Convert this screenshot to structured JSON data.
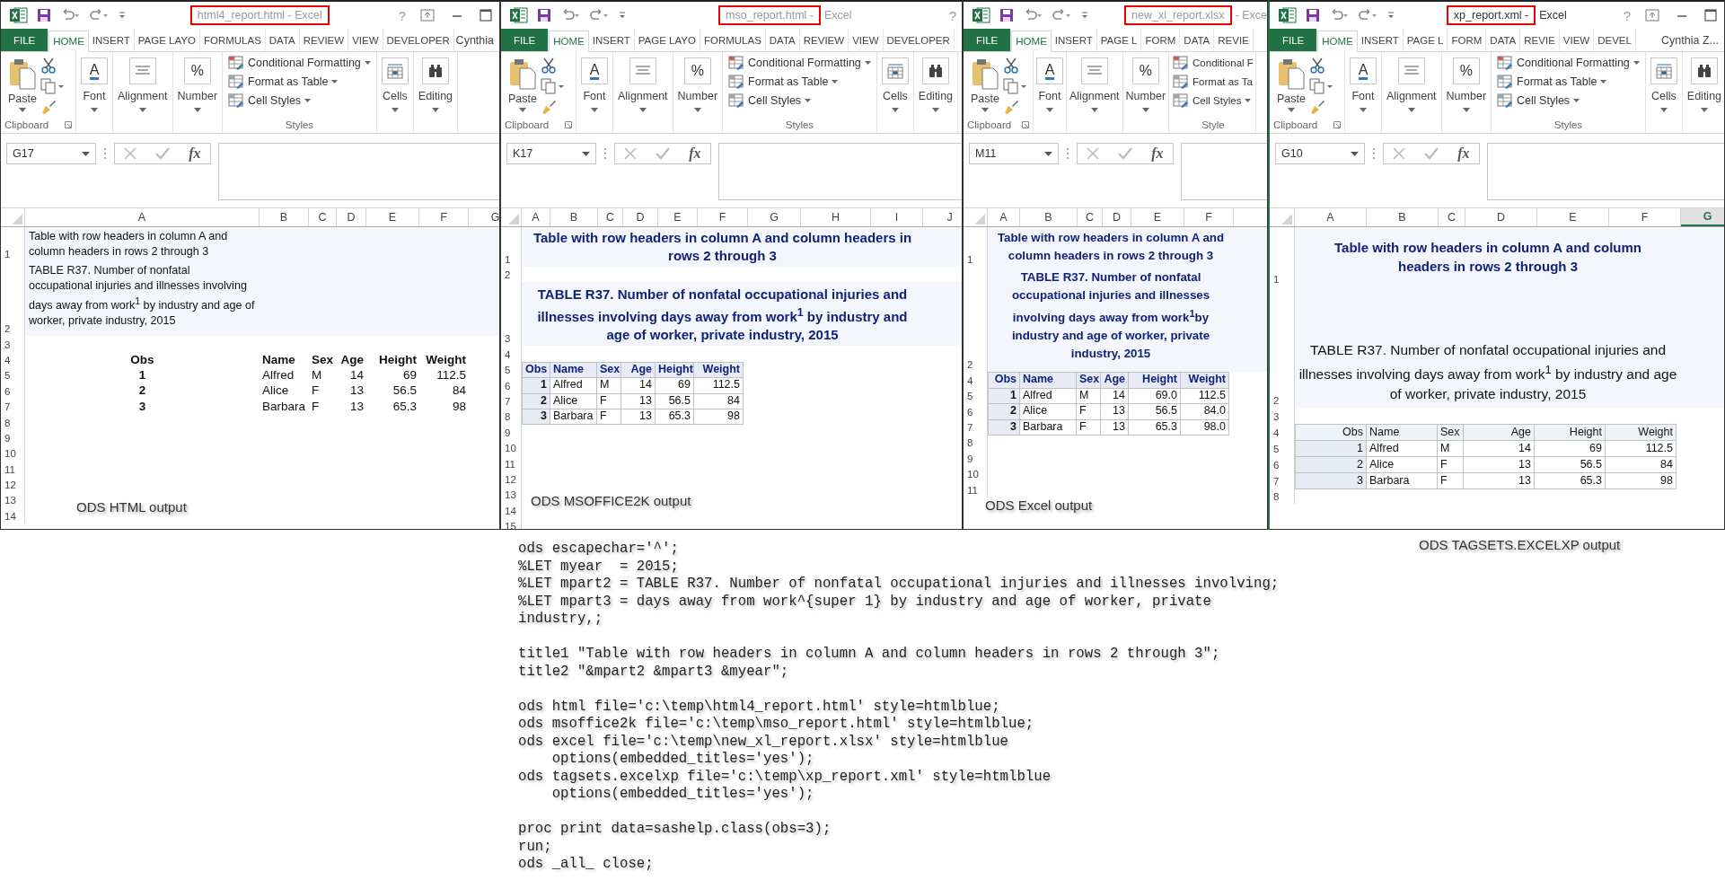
{
  "windows": [
    {
      "kind": "html",
      "title": {
        "highlighted": "html4_report.html - Excel"
      },
      "help": "?",
      "show_controls": true,
      "tabs": [
        {
          "label": "FILE",
          "kind": "file",
          "selected": false
        },
        {
          "label": "HOME",
          "kind": "tab",
          "selected": true
        },
        {
          "label": "INSERT",
          "kind": "tab",
          "selected": false
        },
        {
          "label": "PAGE LAYO",
          "kind": "tab",
          "selected": false
        },
        {
          "label": "FORMULAS",
          "kind": "tab",
          "selected": false
        },
        {
          "label": "DATA",
          "kind": "tab",
          "selected": false
        },
        {
          "label": "REVIEW",
          "kind": "tab",
          "selected": false
        },
        {
          "label": "VIEW",
          "kind": "tab",
          "selected": false
        },
        {
          "label": "DEVELOPER",
          "kind": "tab",
          "selected": false
        }
      ],
      "user": "Cynthia",
      "ribbon": {
        "clipboard": {
          "paste": "Paste",
          "label": "Clipboard"
        },
        "collapsed": [
          {
            "kind": "font",
            "label": "Font",
            "glyph": "A"
          },
          {
            "kind": "alignment",
            "label": "Alignment"
          },
          {
            "kind": "number",
            "label": "Number",
            "glyph": "%"
          }
        ],
        "styles": {
          "commands": [
            {
              "label": "Conditional Formatting",
              "caret": true
            },
            {
              "label": "Format as Table",
              "caret": true
            },
            {
              "label": "Cell Styles",
              "caret": true
            }
          ],
          "label": "Styles"
        },
        "tools": [
          {
            "kind": "cells",
            "label": "Cells"
          },
          {
            "kind": "editing",
            "label": "Editing"
          }
        ]
      },
      "formula_bar": {
        "name_box": "G17",
        "fx": "fx"
      },
      "columns": [
        {
          "label": "A",
          "selected": false
        },
        {
          "label": "B",
          "selected": false
        },
        {
          "label": "C",
          "selected": false
        },
        {
          "label": "D",
          "selected": false
        },
        {
          "label": "E",
          "selected": false
        },
        {
          "label": "F",
          "selected": false
        },
        {
          "label": "G",
          "selected": false
        }
      ],
      "rows": [
        {
          "number": "1",
          "kind": "title",
          "text": "Table with row headers in column A and column headers in rows 2 through 3"
        },
        {
          "number": "2",
          "kind": "subtitle",
          "text": "TABLE R37. Number of nonfatal occupational injuries and illnesses involving days away from work$^{1}$ by industry and age of worker, private industry, 2015"
        },
        {
          "number": "3",
          "kind": "empty"
        },
        {
          "number": "4",
          "kind": "header",
          "cells": [
            "Obs",
            "Name",
            "Sex",
            "Age",
            "Height",
            "Weight"
          ]
        },
        {
          "number": "5",
          "kind": "data",
          "cells": [
            "1",
            "Alfred",
            "M",
            "14",
            "69",
            "112.5"
          ]
        },
        {
          "number": "6",
          "kind": "data",
          "cells": [
            "2",
            "Alice",
            "F",
            "13",
            "56.5",
            "84"
          ]
        },
        {
          "number": "7",
          "kind": "data",
          "cells": [
            "3",
            "Barbara",
            "F",
            "13",
            "65.3",
            "98"
          ]
        },
        {
          "number": "8",
          "kind": "empty"
        },
        {
          "number": "9",
          "kind": "empty"
        },
        {
          "number": "10",
          "kind": "empty"
        },
        {
          "number": "11",
          "kind": "empty"
        },
        {
          "number": "12",
          "kind": "empty"
        },
        {
          "number": "13",
          "kind": "empty"
        },
        {
          "number": "14",
          "kind": "empty"
        }
      ],
      "caption": "ODS HTML output"
    },
    {
      "kind": "msoffice",
      "title": {
        "highlighted": "mso_report.html -",
        "rest": "Excel"
      },
      "help": "?",
      "show_controls": false,
      "tabs": [
        {
          "label": "FILE",
          "kind": "file",
          "selected": false
        },
        {
          "label": "HOME",
          "kind": "tab",
          "selected": true
        },
        {
          "label": "INSERT",
          "kind": "tab",
          "selected": false
        },
        {
          "label": "PAGE LAYO",
          "kind": "tab",
          "selected": false
        },
        {
          "label": "FORMULAS",
          "kind": "tab",
          "selected": false
        },
        {
          "label": "DATA",
          "kind": "tab",
          "selected": false
        },
        {
          "label": "REVIEW",
          "kind": "tab",
          "selected": false
        },
        {
          "label": "VIEW",
          "kind": "tab",
          "selected": false
        },
        {
          "label": "DEVELOPER",
          "kind": "tab",
          "selected": false
        }
      ],
      "ribbon": {
        "clipboard": {
          "paste": "Paste",
          "label": "Clipboard"
        },
        "collapsed": [
          {
            "kind": "font",
            "label": "Font",
            "glyph": "A"
          },
          {
            "kind": "alignment",
            "label": "Alignment"
          },
          {
            "kind": "number",
            "label": "Number",
            "glyph": "%"
          }
        ],
        "styles": {
          "commands": [
            {
              "label": "Conditional Formatting",
              "caret": true
            },
            {
              "label": "Format as Table",
              "caret": true
            },
            {
              "label": "Cell Styles",
              "caret": true
            }
          ],
          "label": "Styles"
        },
        "tools": [
          {
            "kind": "cells",
            "label": "Cells"
          },
          {
            "kind": "editing",
            "label": "Editing"
          }
        ]
      },
      "formula_bar": {
        "name_box": "K17",
        "fx": "fx"
      },
      "columns": [
        {
          "label": "A",
          "selected": false
        },
        {
          "label": "B",
          "selected": false
        },
        {
          "label": "C",
          "selected": false
        },
        {
          "label": "D",
          "selected": false
        },
        {
          "label": "E",
          "selected": false
        },
        {
          "label": "F",
          "selected": false
        },
        {
          "label": "G",
          "selected": false
        },
        {
          "label": "H",
          "selected": false
        },
        {
          "label": "I",
          "selected": false
        },
        {
          "label": "J",
          "selected": false
        }
      ],
      "rows": [
        {
          "number": "1",
          "kind": "title",
          "text": "Table with row headers in column A and column headers in rows 2 through 3"
        },
        {
          "number": "2",
          "kind": "empty"
        },
        {
          "number": "3",
          "kind": "subtitle",
          "text": "TABLE R37. Number of nonfatal occupational injuries and illnesses involving days away from work$^{1}$ by industry and age of worker, private industry, 2015"
        },
        {
          "number": "4",
          "kind": "empty"
        },
        {
          "number": "5",
          "kind": "header",
          "cells": [
            "Obs",
            "Name",
            "Sex",
            "Age",
            "Height",
            "Weight"
          ]
        },
        {
          "number": "6",
          "kind": "data",
          "cells": [
            "1",
            "Alfred",
            "M",
            "14",
            "69",
            "112.5"
          ]
        },
        {
          "number": "7",
          "kind": "data",
          "cells": [
            "2",
            "Alice",
            "F",
            "13",
            "56.5",
            "84"
          ]
        },
        {
          "number": "8",
          "kind": "data",
          "cells": [
            "3",
            "Barbara",
            "F",
            "13",
            "65.3",
            "98"
          ]
        },
        {
          "number": "9",
          "kind": "empty"
        },
        {
          "number": "10",
          "kind": "empty"
        },
        {
          "number": "11",
          "kind": "empty"
        },
        {
          "number": "12",
          "kind": "empty"
        },
        {
          "number": "13",
          "kind": "empty"
        },
        {
          "number": "14",
          "kind": "empty"
        },
        {
          "number": "15",
          "kind": "empty"
        }
      ],
      "caption": "ODS MSOFFICE2K output"
    },
    {
      "kind": "excel",
      "title": {
        "highlighted": "new_xl_report.xlsx",
        "rest": "- Exce"
      },
      "show_controls": false,
      "tabs": [
        {
          "label": "FILE",
          "kind": "file",
          "selected": false
        },
        {
          "label": "HOME",
          "kind": "tab",
          "selected": true
        },
        {
          "label": "INSERT",
          "kind": "tab",
          "selected": false
        },
        {
          "label": "PAGE L",
          "kind": "tab",
          "selected": false
        },
        {
          "label": "FORM",
          "kind": "tab",
          "selected": false
        },
        {
          "label": "DATA",
          "kind": "tab",
          "selected": false
        },
        {
          "label": "REVIE",
          "kind": "tab",
          "selected": false
        }
      ],
      "ribbon": {
        "clipboard": {
          "paste": "Paste",
          "label": "Clipboard"
        },
        "collapsed": [
          {
            "kind": "font",
            "label": "Font",
            "glyph": "A"
          },
          {
            "kind": "alignment",
            "label": "Alignment"
          },
          {
            "kind": "number",
            "label": "Number",
            "glyph": "%"
          }
        ],
        "styles": {
          "commands": [
            {
              "label": "Conditional F",
              "caret": false
            },
            {
              "label": "Format as Ta",
              "caret": false
            },
            {
              "label": "Cell Styles",
              "caret": true
            }
          ],
          "label": "Style"
        }
      },
      "formula_bar": {
        "name_box": "M11",
        "fx": "fx"
      },
      "columns": [
        {
          "label": "A",
          "selected": false
        },
        {
          "label": "B",
          "selected": false
        },
        {
          "label": "C",
          "selected": false
        },
        {
          "label": "D",
          "selected": false
        },
        {
          "label": "E",
          "selected": false
        },
        {
          "label": "F",
          "selected": false
        }
      ],
      "rows": [
        {
          "number": "1",
          "kind": "title",
          "text": "Table with row headers in column A and column headers in rows 2 through 3"
        },
        {
          "number": "2",
          "kind": "subtitle",
          "text": "TABLE R37. Number of nonfatal occupational injuries and illnesses involving days away from work$^{1}$by industry and age of worker, private industry, 2015"
        },
        {
          "number": "4",
          "kind": "header",
          "cells": [
            "Obs",
            "Name",
            "Sex",
            "Age",
            "Height",
            "Weight"
          ]
        },
        {
          "number": "5",
          "kind": "data",
          "cells": [
            "1",
            "Alfred",
            "M",
            "14",
            "69.0",
            "112.5"
          ]
        },
        {
          "number": "6",
          "kind": "data",
          "cells": [
            "2",
            "Alice",
            "F",
            "13",
            "56.5",
            "84.0"
          ]
        },
        {
          "number": "7",
          "kind": "data",
          "cells": [
            "3",
            "Barbara",
            "F",
            "13",
            "65.3",
            "98.0"
          ]
        },
        {
          "number": "8",
          "kind": "empty"
        },
        {
          "number": "9",
          "kind": "empty"
        },
        {
          "number": "10",
          "kind": "empty"
        },
        {
          "number": "11",
          "kind": "empty"
        }
      ],
      "caption": "ODS Excel output"
    },
    {
      "kind": "excelxp",
      "title": {
        "highlighted": "xp_report.xml -",
        "rest": "Excel"
      },
      "help": "?",
      "show_controls": true,
      "tabs": [
        {
          "label": "FILE",
          "kind": "file",
          "selected": false
        },
        {
          "label": "HOME",
          "kind": "tab",
          "selected": true
        },
        {
          "label": "INSERT",
          "kind": "tab",
          "selected": false
        },
        {
          "label": "PAGE L",
          "kind": "tab",
          "selected": false
        },
        {
          "label": "FORM",
          "kind": "tab",
          "selected": false
        },
        {
          "label": "DATA",
          "kind": "tab",
          "selected": false
        },
        {
          "label": "REVIE",
          "kind": "tab",
          "selected": false
        },
        {
          "label": "VIEW",
          "kind": "tab",
          "selected": false
        },
        {
          "label": "DEVEL",
          "kind": "tab",
          "selected": false
        }
      ],
      "user": "Cynthia Z...",
      "ribbon": {
        "clipboard": {
          "paste": "Paste",
          "label": "Clipboard"
        },
        "collapsed": [
          {
            "kind": "font",
            "label": "Font",
            "glyph": "A"
          },
          {
            "kind": "alignment",
            "label": "Alignment"
          },
          {
            "kind": "number",
            "label": "Number",
            "glyph": "%"
          }
        ],
        "styles": {
          "commands": [
            {
              "label": "Conditional Formatting",
              "caret": true
            },
            {
              "label": "Format as Table",
              "caret": true
            },
            {
              "label": "Cell Styles",
              "caret": true
            }
          ],
          "label": "Styles"
        },
        "tools": [
          {
            "kind": "cells",
            "label": "Cells"
          },
          {
            "kind": "editing",
            "label": "Editing"
          }
        ]
      },
      "formula_bar": {
        "name_box": "G10",
        "fx": "fx"
      },
      "columns": [
        {
          "label": "A",
          "selected": false
        },
        {
          "label": "B",
          "selected": false
        },
        {
          "label": "C",
          "selected": false
        },
        {
          "label": "D",
          "selected": false
        },
        {
          "label": "E",
          "selected": false
        },
        {
          "label": "F",
          "selected": false
        },
        {
          "label": "G",
          "selected": true
        }
      ],
      "rows": [
        {
          "number": "1",
          "kind": "title",
          "text": "Table with row headers in column A and column headers in rows 2 through 3"
        },
        {
          "number": "2",
          "kind": "subtitle",
          "text": "TABLE R37. Number of nonfatal occupational injuries and illnesses involving days away from work$^{1}$ by industry and age of worker, private industry, 2015"
        },
        {
          "number": "3",
          "kind": "empty"
        },
        {
          "number": "4",
          "kind": "header",
          "cells": [
            "Obs",
            "Name",
            "Sex",
            "Age",
            "Height",
            "Weight"
          ]
        },
        {
          "number": "5",
          "kind": "data",
          "cells": [
            "1",
            "Alfred",
            "M",
            "14",
            "69",
            "112.5"
          ]
        },
        {
          "number": "6",
          "kind": "data",
          "cells": [
            "2",
            "Alice",
            "F",
            "13",
            "56.5",
            "84"
          ]
        },
        {
          "number": "7",
          "kind": "data",
          "cells": [
            "3",
            "Barbara",
            "F",
            "13",
            "65.3",
            "98"
          ]
        },
        {
          "number": "8",
          "kind": "empty"
        }
      ],
      "caption": "ODS TAGSETS.EXCELXP output"
    }
  ],
  "code": {
    "blocks": [
      [
        "ods escapechar='^';",
        "%LET myear  = 2015;",
        "%LET mpart2 = TABLE R37. Number of nonfatal occupational injuries and illnesses involving;",
        "%LET mpart3 = days away from work^{super 1} by industry and age of worker, private",
        "industry,;"
      ],
      [
        "title1 \"Table with row headers in column A and column headers in rows 2 through 3\";",
        "title2 \"&mpart2 &mpart3 &myear\";"
      ],
      [
        "ods html file='c:\\temp\\html4_report.html' style=htmlblue;",
        "ods msoffice2k file='c:\\temp\\mso_report.html' style=htmlblue;",
        "ods excel file='c:\\temp\\new_xl_report.xlsx' style=htmlblue",
        "    options(embedded_titles='yes');",
        "ods tagsets.excelxp file='c:\\temp\\xp_report.xml' style=htmlblue",
        "    options(embedded_titles='yes');"
      ],
      [
        "proc print data=sashelp.class(obs=3);",
        "run;",
        "ods _all_ close;"
      ]
    ]
  }
}
